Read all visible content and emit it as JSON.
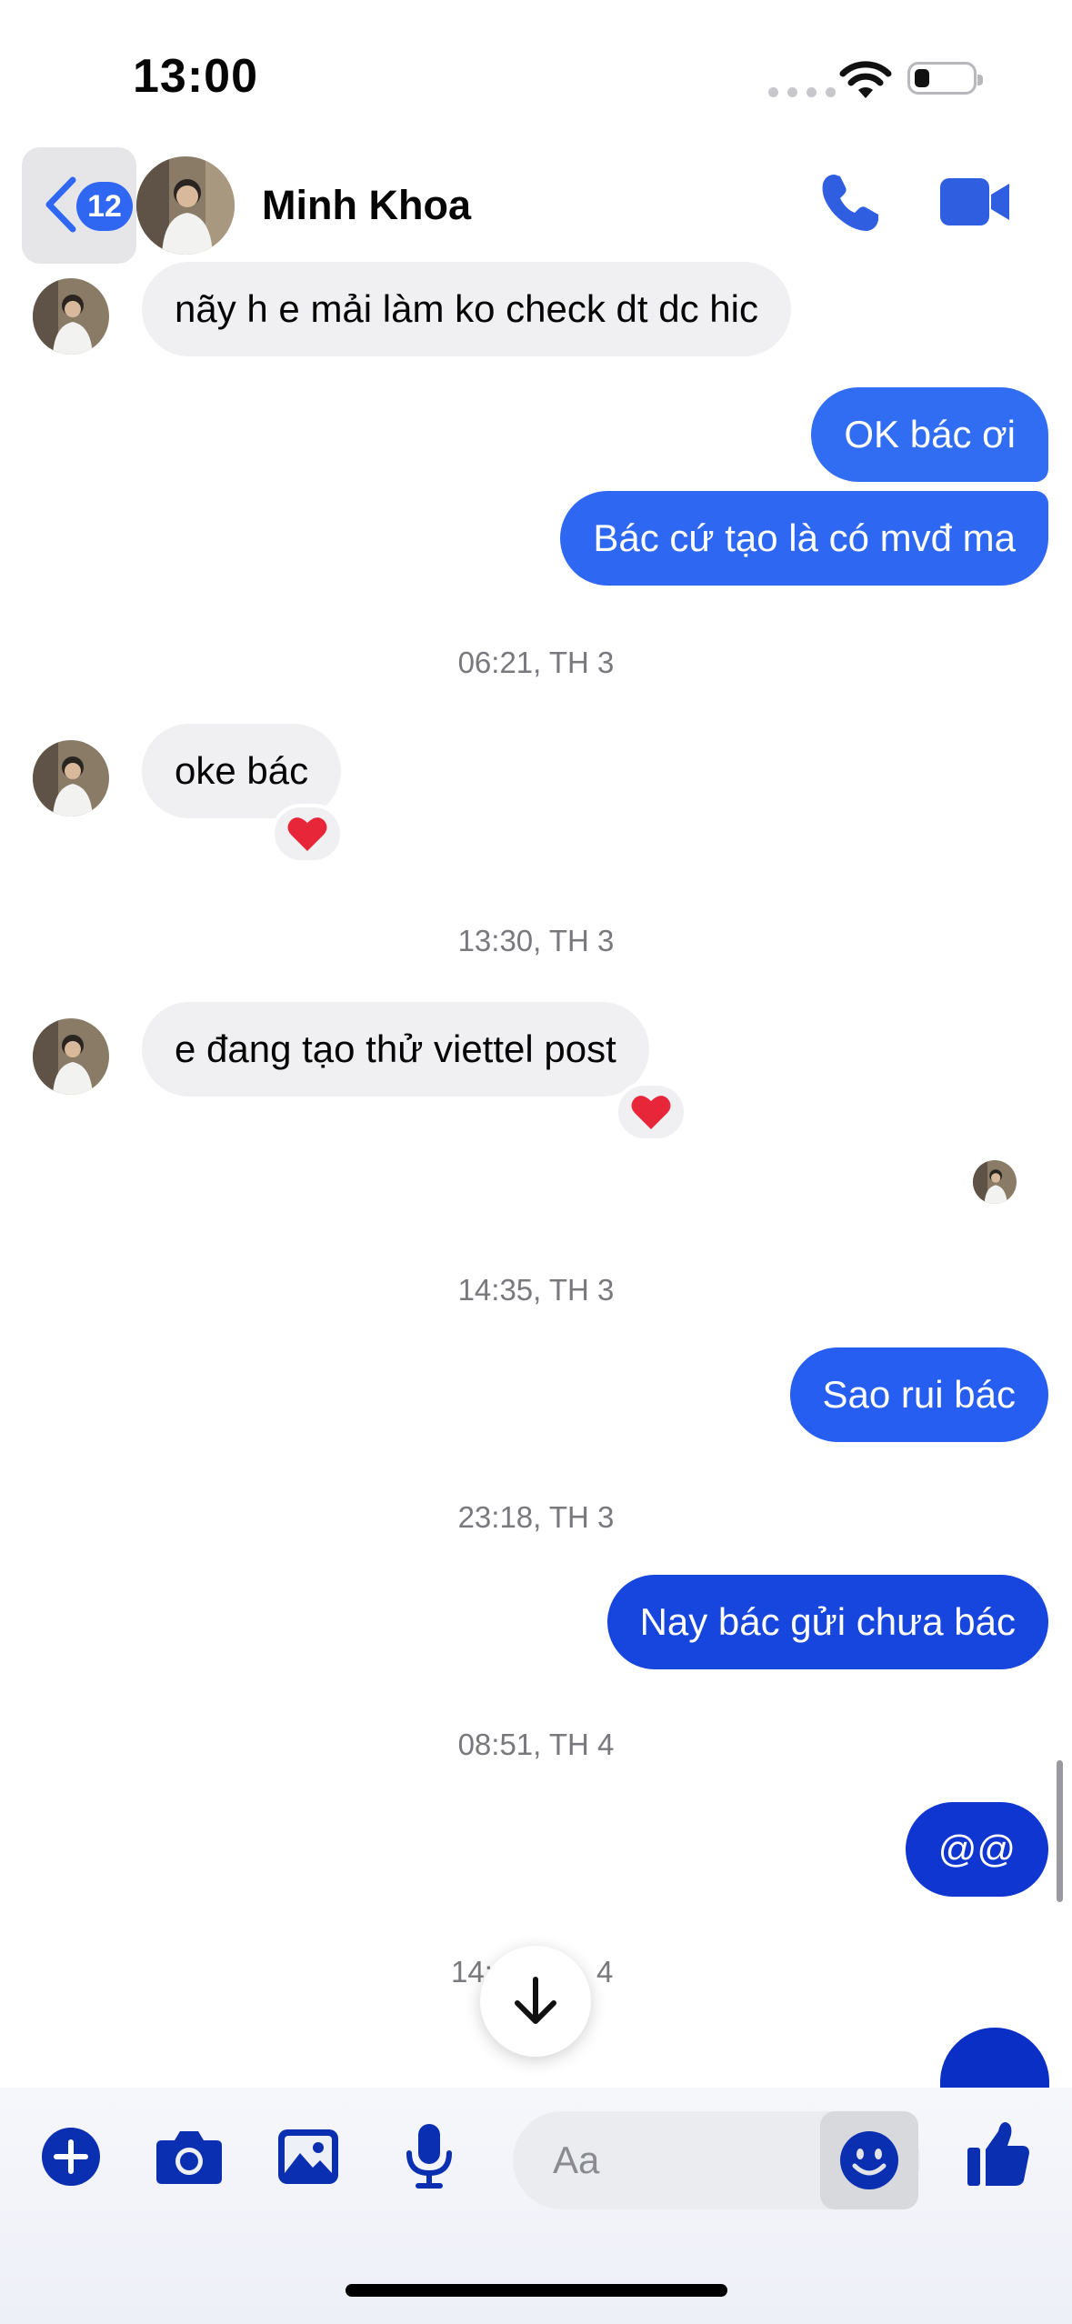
{
  "status_bar": {
    "time": "13:00"
  },
  "header": {
    "unread_count": "12",
    "contact_name": "Minh Khoa",
    "call_icon": "phone-icon",
    "video_icon": "video-camera-icon"
  },
  "colors": {
    "bubble_in": "#f0f0f3",
    "bubble_out_top": "#2f6cf2",
    "bubble_out_bottom": "#0a2fc4",
    "icon_blue": "#0a2fb0"
  },
  "messages": [
    {
      "dir": "in",
      "text": "nãy h e mải làm ko check dt dc hic"
    },
    {
      "dir": "out",
      "text": "OK bác ơi"
    },
    {
      "dir": "out",
      "text": "Bác cứ tạo là có mvđ ma"
    },
    {
      "type": "timestamp",
      "text": "06:21, TH 3"
    },
    {
      "dir": "in",
      "text": "oke bác",
      "reaction": "❤️"
    },
    {
      "type": "timestamp",
      "text": "13:30, TH 3"
    },
    {
      "dir": "in",
      "text": "e đang tạo thử viettel post",
      "reaction": "❤️"
    },
    {
      "type": "timestamp",
      "text": "14:35, TH 3"
    },
    {
      "dir": "out",
      "text": "Sao rui bác"
    },
    {
      "type": "timestamp",
      "text": "23:18, TH 3"
    },
    {
      "dir": "out",
      "text": "Nay bác gửi chưa bác"
    },
    {
      "type": "timestamp",
      "text": "08:51, TH 4"
    },
    {
      "dir": "out",
      "text": "@@"
    },
    {
      "type": "timestamp",
      "text": "14:",
      "partial": true,
      "text_end": "4"
    }
  ],
  "composer": {
    "placeholder": "Aa",
    "icons": [
      "plus-icon",
      "camera-icon",
      "photo-icon",
      "microphone-icon",
      "emoji-icon",
      "thumbs-up-icon"
    ]
  }
}
